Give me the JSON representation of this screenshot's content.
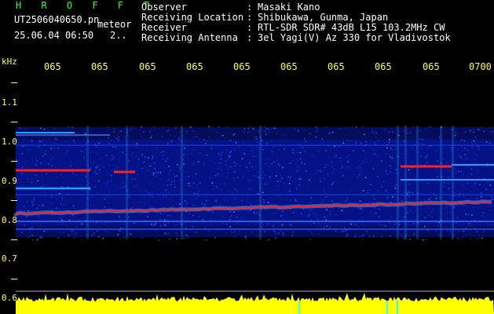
{
  "app": {
    "title": "H R O F F T"
  },
  "file": {
    "name": "UT2506040650.pn",
    "tag": "meteor",
    "date_time": "25.06.04 06:50",
    "counter": "2.."
  },
  "station": [
    {
      "label": "Observer",
      "sep": ":",
      "value": "Masaki Kano"
    },
    {
      "label": "Receiving Location",
      "sep": ":",
      "value": "Shibukawa, Gunma, Japan"
    },
    {
      "label": "Receiver",
      "sep": ":",
      "value": "RTL-SDR SDR# 43dB L15 103.2MHz CW"
    },
    {
      "label": "Receiving Antenna",
      "sep": ":",
      "value": "3el Yagi(V) Az 330 for Vladivostok"
    }
  ],
  "axes": {
    "freq_unit": "kHz",
    "freq_ticks": [
      "1.1",
      "1.0",
      "0.9",
      "0.8",
      "0.7",
      "0.6"
    ],
    "time_ticks": [
      "065",
      "065",
      "065",
      "065",
      "065",
      "065",
      "065",
      "065",
      "065",
      "0700"
    ]
  },
  "colors": {
    "background": "#000000",
    "header_text": "#ffffff",
    "title_text": "#30ff30",
    "axis_text": "#ffff40",
    "signal_noise": "#0818a8",
    "signal_mid": "#1ea0ff",
    "signal_hot": "#ff2020",
    "level_bar": "#ffff00"
  }
}
